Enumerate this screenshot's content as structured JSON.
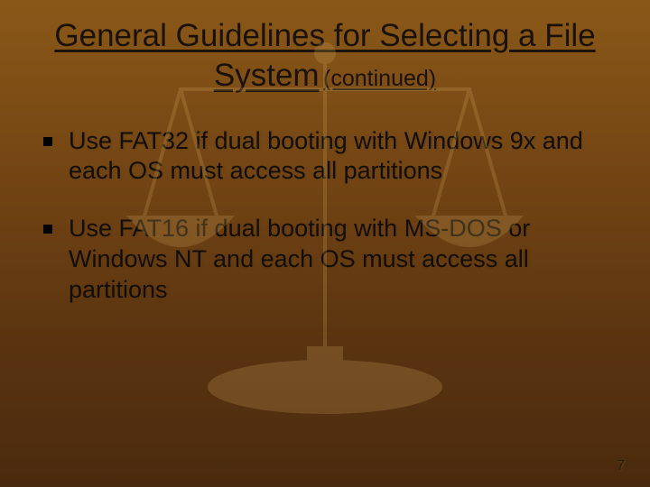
{
  "title": {
    "main": "General Guidelines for Selecting a File System",
    "continued": "(continued)"
  },
  "bullets": [
    {
      "text": "Use FAT32 if dual booting with Windows 9x and each OS must access all partitions"
    },
    {
      "text": "Use FAT16 if dual booting with MS-DOS or Windows NT and each OS must access all partitions"
    }
  ],
  "page_number": "7"
}
